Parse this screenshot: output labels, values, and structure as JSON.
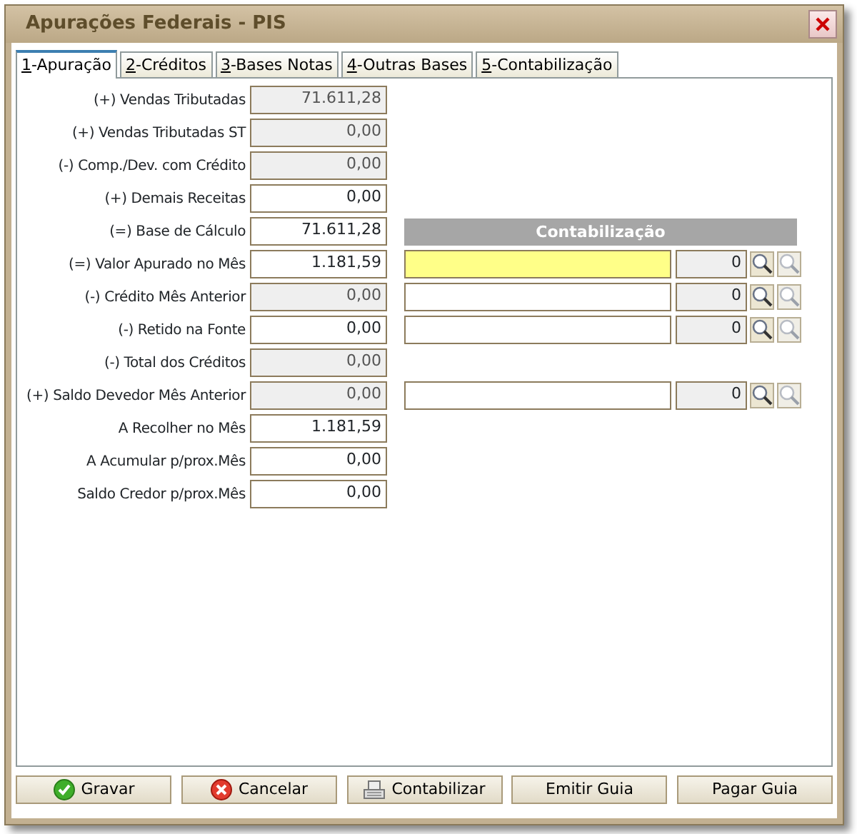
{
  "window": {
    "title": "Apurações Federais - PIS"
  },
  "tabs": [
    {
      "label": "1-Apuração",
      "selected": true
    },
    {
      "label": "2-Créditos",
      "selected": false
    },
    {
      "label": "3-Bases Notas",
      "selected": false
    },
    {
      "label": "4-Outras Bases",
      "selected": false
    },
    {
      "label": "5-Contabilização",
      "selected": false
    }
  ],
  "contabilizacao_header": "Contabilização",
  "rows": [
    {
      "label": "(+) Vendas Tributadas",
      "value": "71.611,28",
      "disabled": true
    },
    {
      "label": "(+) Vendas Tributadas ST",
      "value": "0,00",
      "disabled": true
    },
    {
      "label": "(-) Comp./Dev. com Crédito",
      "value": "0,00",
      "disabled": true
    },
    {
      "label": "(+) Demais Receitas",
      "value": "0,00",
      "disabled": false
    },
    {
      "label": "(=) Base de Cálculo",
      "value": "71.611,28",
      "disabled": false,
      "header_here": true
    },
    {
      "label": "(=) Valor Apurado no Mês",
      "value": "1.181,59",
      "disabled": false,
      "account": {
        "code": "0",
        "focused": true
      }
    },
    {
      "label": "(-) Crédito Mês Anterior",
      "value": "0,00",
      "disabled": true,
      "account": {
        "code": "0",
        "focused": false
      }
    },
    {
      "label": "(-) Retido na Fonte",
      "value": "0,00",
      "disabled": false,
      "account": {
        "code": "0",
        "focused": false
      }
    },
    {
      "label": "(-) Total dos Créditos",
      "value": "0,00",
      "disabled": true
    },
    {
      "label": "(+) Saldo Devedor Mês Anterior",
      "value": "0,00",
      "disabled": true,
      "account": {
        "code": "0",
        "focused": false
      }
    },
    {
      "label": "A Recolher no Mês",
      "value": "1.181,59",
      "disabled": false
    },
    {
      "label": "A Acumular p/prox.Mês",
      "value": "0,00",
      "disabled": false
    },
    {
      "label": "Saldo Credor p/prox.Mês",
      "value": "0,00",
      "disabled": false
    }
  ],
  "buttons": [
    {
      "label": "Gravar",
      "kind": "save"
    },
    {
      "label": "Cancelar",
      "kind": "cancel"
    },
    {
      "label": "Contabilizar",
      "kind": "register"
    },
    {
      "label": "Emitir Guia",
      "kind": "plain"
    },
    {
      "label": "Pagar Guia",
      "kind": "plain"
    }
  ]
}
